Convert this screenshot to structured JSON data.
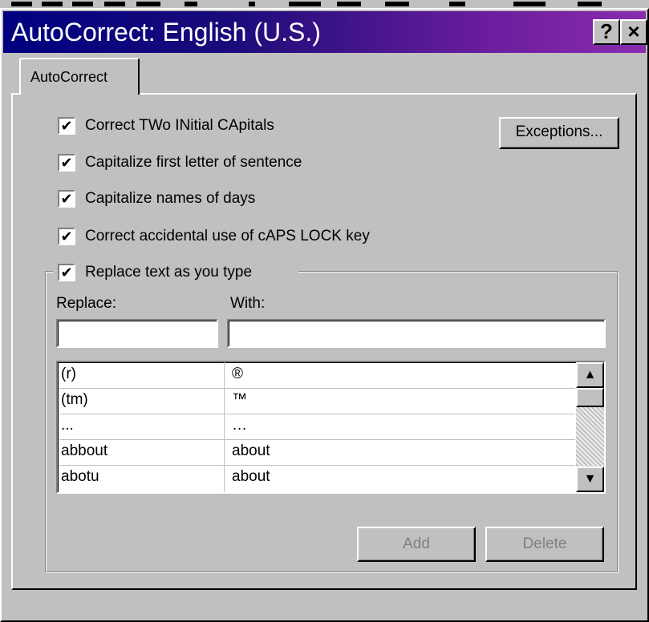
{
  "window": {
    "title": "AutoCorrect: English (U.S.)",
    "help_label": "?",
    "close_label": "×"
  },
  "tabs": [
    {
      "label": "AutoCorrect"
    }
  ],
  "options": [
    {
      "label": "Correct TWo INitial CApitals",
      "checked": true
    },
    {
      "label": "Capitalize first letter of sentence",
      "checked": true
    },
    {
      "label": "Capitalize names of days",
      "checked": true
    },
    {
      "label": "Correct accidental use of cAPS LOCK key",
      "checked": true
    }
  ],
  "exceptions_button": "Exceptions...",
  "replace_group": {
    "label": "Replace text as you type",
    "checked": true,
    "replace_label": "Replace:",
    "with_label": "With:",
    "replace_value": "",
    "with_value": ""
  },
  "entries": [
    {
      "replace": "(r)",
      "with": "®"
    },
    {
      "replace": "(tm)",
      "with": "™"
    },
    {
      "replace": "...",
      "with": "…"
    },
    {
      "replace": "abbout",
      "with": "about"
    },
    {
      "replace": "abotu",
      "with": "about"
    }
  ],
  "buttons": {
    "add": "Add",
    "delete": "Delete"
  },
  "check_mark": "✔",
  "scroll_up": "▲",
  "scroll_down": "▼"
}
